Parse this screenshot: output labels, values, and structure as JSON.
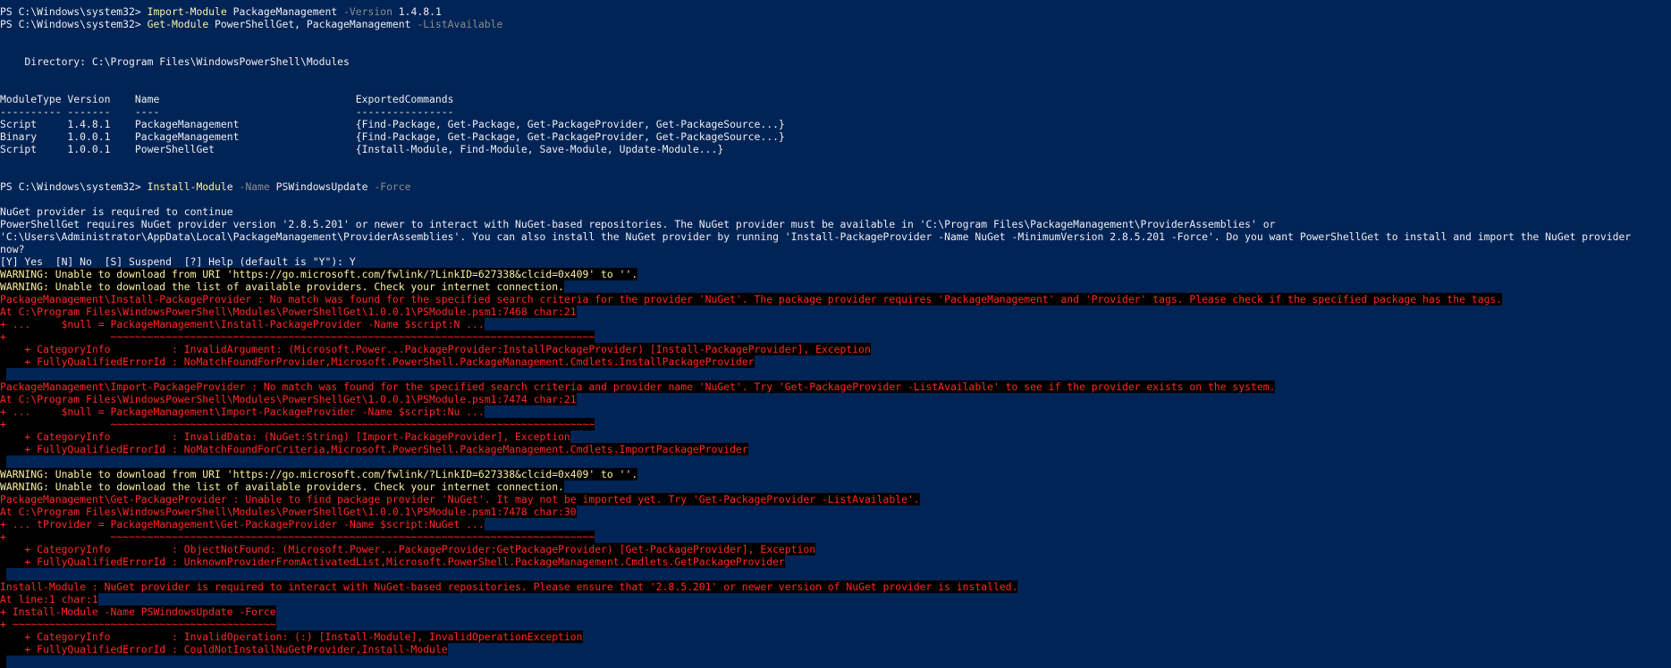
{
  "window": {
    "background": "#012456",
    "default_color": "#eeedf0",
    "colors": {
      "command": "#f9f1a5",
      "parameter": "#8c8c8c",
      "warning_fg": "#f9f1a5",
      "error_fg": "#ff2828",
      "highlight_bg": "#000000"
    }
  },
  "lines": [
    [
      {
        "t": "PS C:\\Windows\\system32> ",
        "c": "plain"
      },
      {
        "t": "Import-Module",
        "c": "cmd"
      },
      {
        "t": " PackageManagement ",
        "c": "plain"
      },
      {
        "t": "-Version",
        "c": "param"
      },
      {
        "t": " 1.4.8.1",
        "c": "plain"
      }
    ],
    [
      {
        "t": "PS C:\\Windows\\system32> ",
        "c": "plain"
      },
      {
        "t": "Get-Module",
        "c": "cmd"
      },
      {
        "t": " PowerShellGet, PackageManagement ",
        "c": "plain"
      },
      {
        "t": "-ListAvailable",
        "c": "param"
      }
    ],
    [],
    [],
    [
      {
        "t": "    Directory: C:\\Program Files\\WindowsPowerShell\\Modules",
        "c": "plain"
      }
    ],
    [],
    [],
    [
      {
        "t": "ModuleType Version    Name                                ExportedCommands",
        "c": "plain"
      }
    ],
    [
      {
        "t": "---------- -------    ----                                ----------------",
        "c": "plain"
      }
    ],
    [
      {
        "t": "Script     1.4.8.1    PackageManagement                   {Find-Package, Get-Package, Get-PackageProvider, Get-PackageSource...}",
        "c": "plain"
      }
    ],
    [
      {
        "t": "Binary     1.0.0.1    PackageManagement                   {Find-Package, Get-Package, Get-PackageProvider, Get-PackageSource...}",
        "c": "plain"
      }
    ],
    [
      {
        "t": "Script     1.0.0.1    PowerShellGet                       {Install-Module, Find-Module, Save-Module, Update-Module...}",
        "c": "plain"
      }
    ],
    [],
    [],
    [
      {
        "t": "PS C:\\Windows\\system32> ",
        "c": "plain"
      },
      {
        "t": "Install-Module",
        "c": "cmd"
      },
      {
        "t": " ",
        "c": "plain"
      },
      {
        "t": "-Name",
        "c": "param"
      },
      {
        "t": " PSWindowsUpdate ",
        "c": "plain"
      },
      {
        "t": "-Force",
        "c": "param"
      }
    ],
    [],
    [
      {
        "t": "NuGet provider is required to continue",
        "c": "plain"
      }
    ],
    [
      {
        "t": "PowerShellGet requires NuGet provider version '2.8.5.201' or newer to interact with NuGet-based repositories. The NuGet provider must be available in 'C:\\Program Files\\PackageManagement\\ProviderAssemblies' or",
        "c": "plain"
      }
    ],
    [
      {
        "t": "'C:\\Users\\Administrator\\AppData\\Local\\PackageManagement\\ProviderAssemblies'. You can also install the NuGet provider by running 'Install-PackageProvider -Name NuGet -MinimumVersion 2.8.5.201 -Force'. Do you want PowerShellGet to install and import the NuGet provider",
        "c": "plain"
      }
    ],
    [
      {
        "t": "now?",
        "c": "plain"
      }
    ],
    [
      {
        "t": "[Y] Yes  [N] No  [S] Suspend  [?] Help (default is \"Y\"): Y",
        "c": "plain"
      }
    ],
    [
      {
        "t": "WARNING: Unable to download from URI 'https://go.microsoft.com/fwlink/?LinkID=627338&clcid=0x409' to ''.",
        "c": "warn"
      }
    ],
    [
      {
        "t": "WARNING: Unable to download the list of available providers. Check your internet connection.",
        "c": "warn"
      }
    ],
    [
      {
        "t": "PackageManagement\\Install-PackageProvider : No match was found for the specified search criteria for the provider 'NuGet'. The package provider requires 'PackageManagement' and 'Provider' tags. Please check if the specified package has the tags.",
        "c": "err"
      }
    ],
    [
      {
        "t": "At C:\\Program Files\\WindowsPowerShell\\Modules\\PowerShellGet\\1.0.0.1\\PSModule.psm1:7468 char:21",
        "c": "err"
      }
    ],
    [
      {
        "t": "+ ...     $null = PackageManagement\\Install-PackageProvider -Name $script:N ...",
        "c": "err"
      }
    ],
    [
      {
        "t": "+                 ~~~~~~~~~~~~~~~~~~~~~~~~~~~~~~~~~~~~~~~~~~~~~~~~~~~~~~~~~~~~~~~~~~~~~~~~~~~~~~~",
        "c": "err"
      }
    ],
    [
      {
        "t": "    + CategoryInfo          : InvalidArgument: (Microsoft.Power...PackageProvider:InstallPackageProvider) [Install-PackageProvider], Exception",
        "c": "err"
      }
    ],
    [
      {
        "t": "    + FullyQualifiedErrorId : NoMatchFoundForProvider,Microsoft.PowerShell.PackageManagement.Cmdlets.InstallPackageProvider",
        "c": "err"
      }
    ],
    [
      {
        "t": " ",
        "c": "hl"
      }
    ],
    [
      {
        "t": "PackageManagement\\Import-PackageProvider : No match was found for the specified search criteria and provider name 'NuGet'. Try 'Get-PackageProvider -ListAvailable' to see if the provider exists on the system.",
        "c": "err"
      }
    ],
    [
      {
        "t": "At C:\\Program Files\\WindowsPowerShell\\Modules\\PowerShellGet\\1.0.0.1\\PSModule.psm1:7474 char:21",
        "c": "err"
      }
    ],
    [
      {
        "t": "+ ...     $null = PackageManagement\\Import-PackageProvider -Name $script:Nu ...",
        "c": "err"
      }
    ],
    [
      {
        "t": "+                 ~~~~~~~~~~~~~~~~~~~~~~~~~~~~~~~~~~~~~~~~~~~~~~~~~~~~~~~~~~~~~~~~~~~~~~~~~~~~~~~",
        "c": "err"
      }
    ],
    [
      {
        "t": "    + CategoryInfo          : InvalidData: (NuGet:String) [Import-PackageProvider], Exception",
        "c": "err"
      }
    ],
    [
      {
        "t": "    + FullyQualifiedErrorId : NoMatchFoundForCriteria,Microsoft.PowerShell.PackageManagement.Cmdlets.ImportPackageProvider",
        "c": "err"
      }
    ],
    [
      {
        "t": " ",
        "c": "hl"
      }
    ],
    [
      {
        "t": "WARNING: Unable to download from URI 'https://go.microsoft.com/fwlink/?LinkID=627338&clcid=0x409' to ''.",
        "c": "warn"
      }
    ],
    [
      {
        "t": "WARNING: Unable to download the list of available providers. Check your internet connection.",
        "c": "warn"
      }
    ],
    [
      {
        "t": "PackageManagement\\Get-PackageProvider : Unable to find package provider 'NuGet'. It may not be imported yet. Try 'Get-PackageProvider -ListAvailable'.",
        "c": "err"
      }
    ],
    [
      {
        "t": "At C:\\Program Files\\WindowsPowerShell\\Modules\\PowerShellGet\\1.0.0.1\\PSModule.psm1:7478 char:30",
        "c": "err"
      }
    ],
    [
      {
        "t": "+ ... tProvider = PackageManagement\\Get-PackageProvider -Name $script:NuGet ...",
        "c": "err"
      }
    ],
    [
      {
        "t": "+                 ~~~~~~~~~~~~~~~~~~~~~~~~~~~~~~~~~~~~~~~~~~~~~~~~~~~~~~~~~~~~~~~~~~~~~~~~~~~~~~~",
        "c": "err"
      }
    ],
    [
      {
        "t": "    + CategoryInfo          : ObjectNotFound: (Microsoft.Power...PackageProvider:GetPackageProvider) [Get-PackageProvider], Exception",
        "c": "err"
      }
    ],
    [
      {
        "t": "    + FullyQualifiedErrorId : UnknownProviderFromActivatedList,Microsoft.PowerShell.PackageManagement.Cmdlets.GetPackageProvider",
        "c": "err"
      }
    ],
    [
      {
        "t": " ",
        "c": "hl"
      }
    ],
    [
      {
        "t": "Install-Module : NuGet provider is required to interact with NuGet-based repositories. Please ensure that '2.8.5.201' or newer version of NuGet provider is installed.",
        "c": "err"
      }
    ],
    [
      {
        "t": "At line:1 char:1",
        "c": "err"
      }
    ],
    [
      {
        "t": "+ Install-Module -Name PSWindowsUpdate -Force",
        "c": "err"
      }
    ],
    [
      {
        "t": "+ ~~~~~~~~~~~~~~~~~~~~~~~~~~~~~~~~~~~~~~~~~~~",
        "c": "err"
      }
    ],
    [
      {
        "t": "    + CategoryInfo          : InvalidOperation: (:) [Install-Module], InvalidOperationException",
        "c": "err"
      }
    ],
    [
      {
        "t": "    + FullyQualifiedErrorId : CouldNotInstallNuGetProvider,Install-Module",
        "c": "err"
      }
    ],
    [
      {
        "t": " ",
        "c": "hl"
      }
    ]
  ]
}
